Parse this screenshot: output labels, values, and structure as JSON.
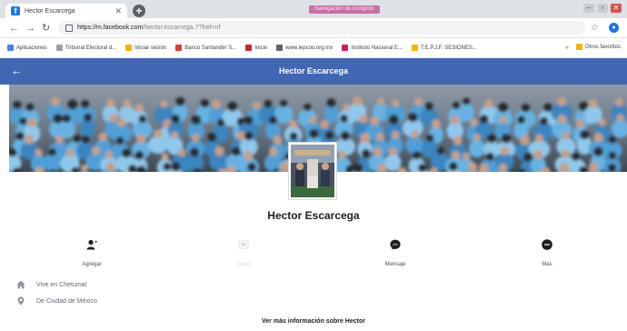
{
  "browser": {
    "tab_title": "Hector Escarcega",
    "incognito_label": "Navegación de incógnito",
    "url_host": "https://m.facebook.com",
    "url_path": "/hector.escarcega.7?fref=nf",
    "bookmarks": [
      {
        "label": "Aplicaciones",
        "color": "#4285f4"
      },
      {
        "label": "Tribunal Electoral d...",
        "color": "#9aa0a6"
      },
      {
        "label": "Iniciar sesión",
        "color": "#f4b400"
      },
      {
        "label": "Banco Santander S...",
        "color": "#e53935"
      },
      {
        "label": "Inicio",
        "color": "#c62828"
      },
      {
        "label": "www.iepcoo.org.mx",
        "color": "#5f6368"
      },
      {
        "label": "Instituto Nacional E...",
        "color": "#d81b60"
      },
      {
        "label": "T.E.P.J.F. SESIONES...",
        "color": "#f4b400"
      }
    ],
    "other_bookmarks": "Otros favoritos"
  },
  "header": {
    "title": "Hector Escarcega"
  },
  "profile": {
    "name": "Hector Escarcega",
    "actions": [
      {
        "label": "Agregar",
        "icon": "add-friend-icon",
        "enabled": true
      },
      {
        "label": "Seguir",
        "icon": "follow-icon",
        "enabled": false
      },
      {
        "label": "Mensaje",
        "icon": "messenger-icon",
        "enabled": true
      },
      {
        "label": "Más",
        "icon": "more-icon",
        "enabled": true
      }
    ],
    "info": [
      {
        "text": "Vive en Chetumal",
        "icon": "home-icon"
      },
      {
        "text": "De Ciudad de México",
        "icon": "location-pin-icon"
      }
    ],
    "more_info": "Ver más información sobre Hector"
  },
  "colors": {
    "brand": "#4267b2",
    "text": "#1c1e21",
    "secondary_text": "#606770"
  }
}
